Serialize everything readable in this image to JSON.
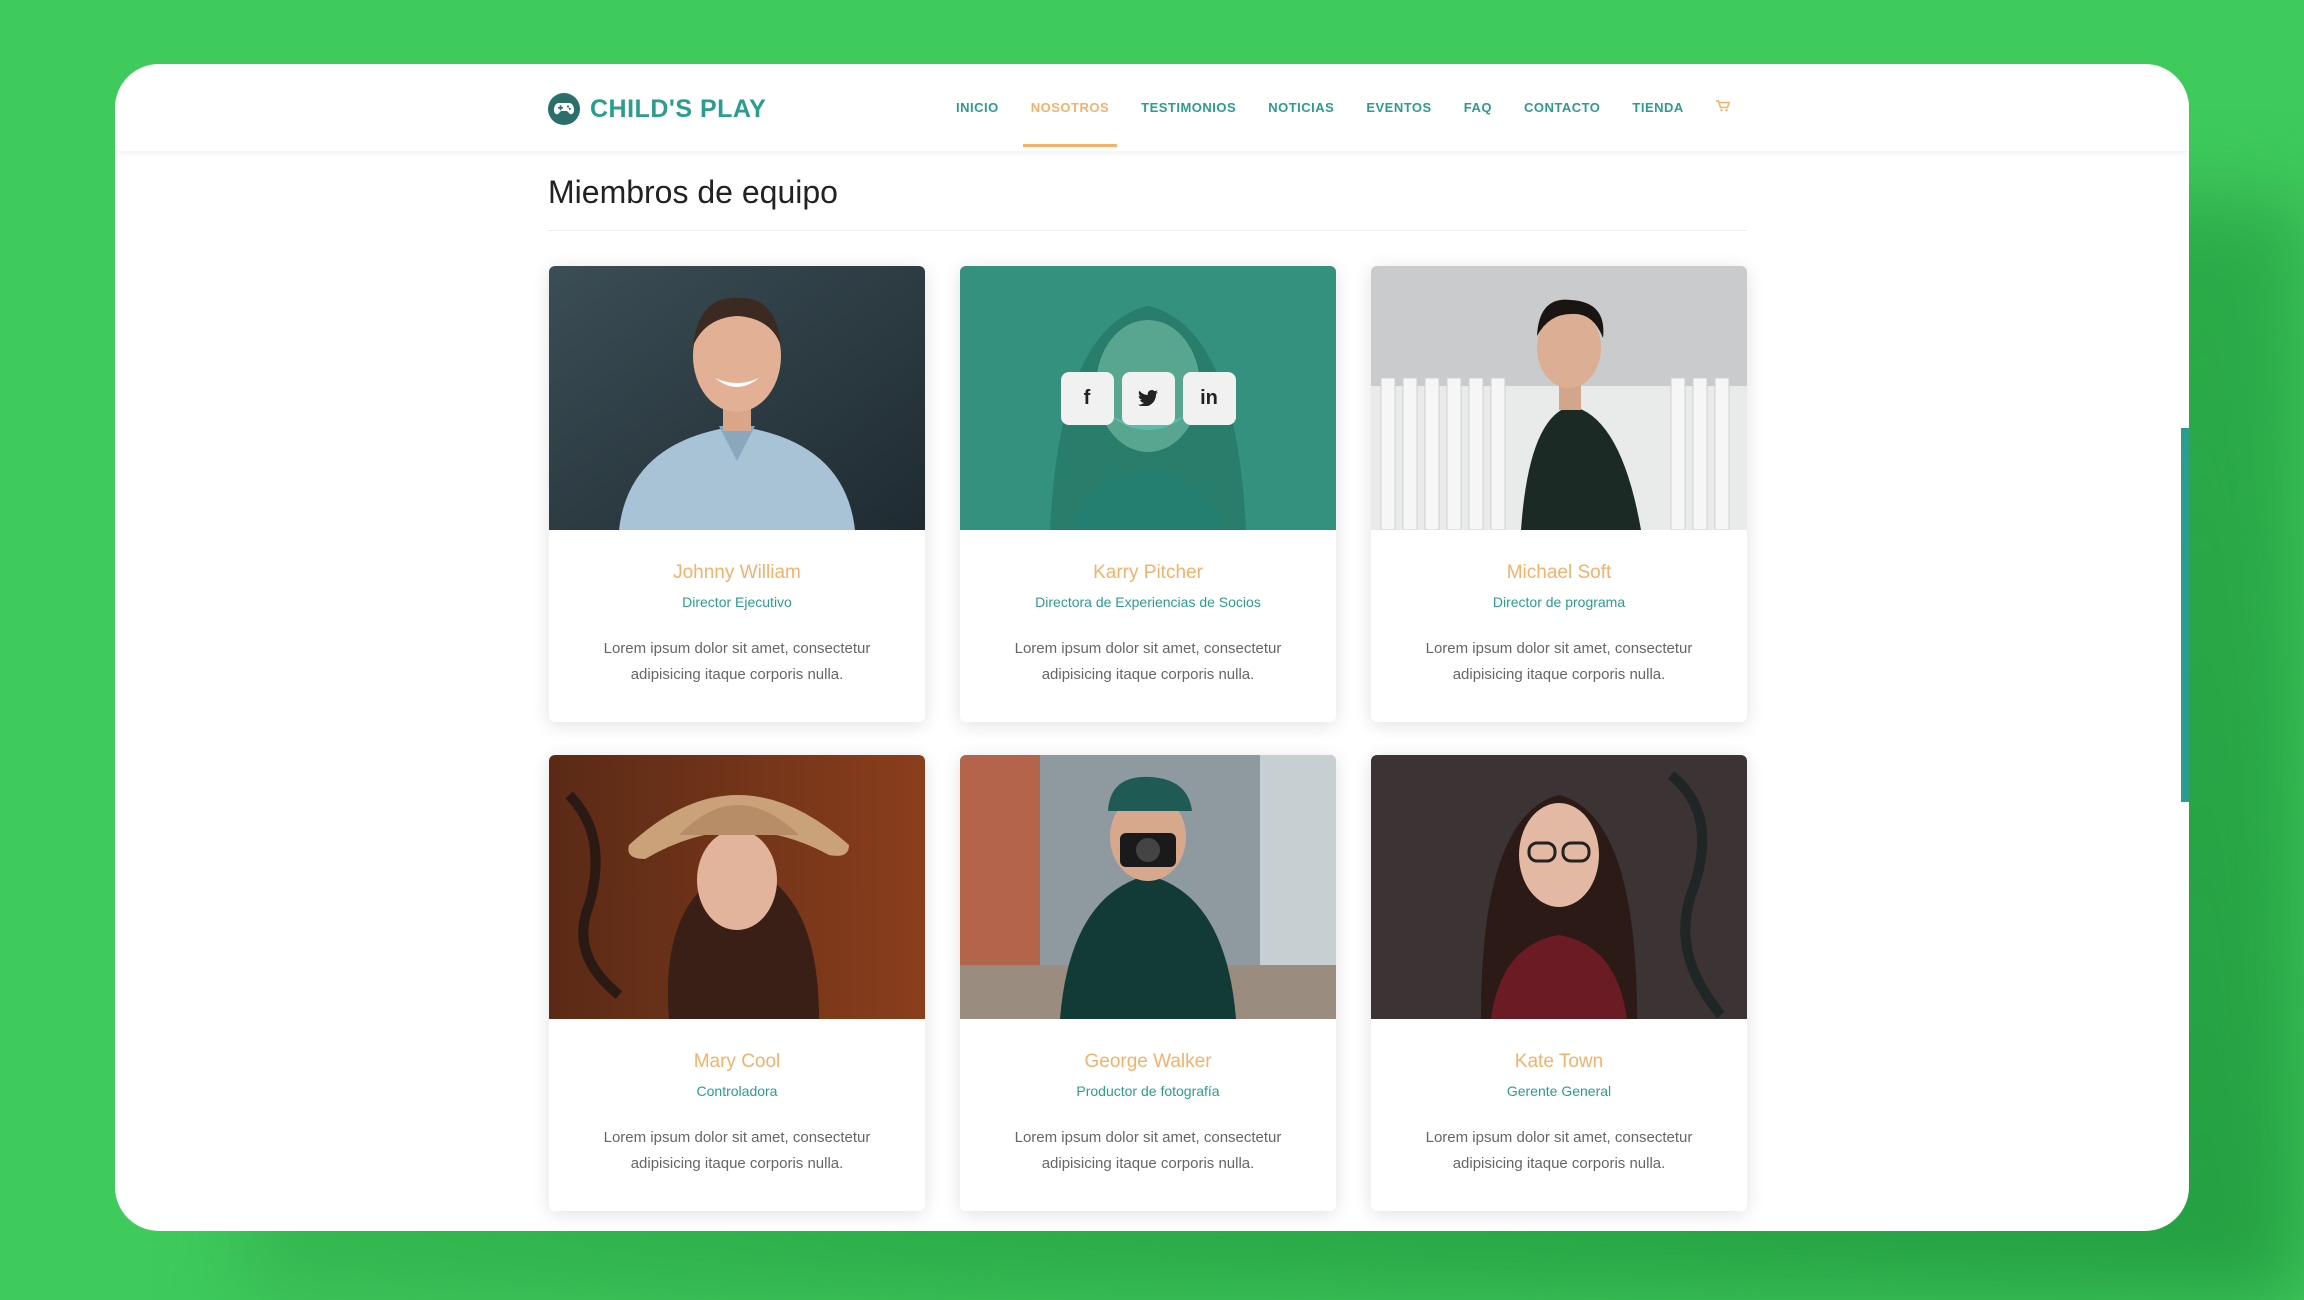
{
  "brand": {
    "name": "CHILD'S PLAY"
  },
  "nav": {
    "items": [
      "INICIO",
      "NOSOTROS",
      "TESTIMONIOS",
      "NOTICIAS",
      "EVENTOS",
      "FAQ",
      "CONTACTO",
      "TIENDA"
    ],
    "active": "NOSOTROS",
    "cart_icon": "cart-icon"
  },
  "section": {
    "title": "Miembros de equipo"
  },
  "social": [
    "f",
    "t",
    "in"
  ],
  "members": [
    {
      "name": "Johnny William",
      "role": "Director Ejecutivo",
      "desc": "Lorem ipsum dolor sit amet, consectetur adipisicing itaque corporis nulla."
    },
    {
      "name": "Karry Pitcher",
      "role": "Directora de Experiencias de Socios",
      "desc": "Lorem ipsum dolor sit amet, consectetur adipisicing itaque corporis nulla."
    },
    {
      "name": "Michael Soft",
      "role": "Director de programa",
      "desc": "Lorem ipsum dolor sit amet, consectetur adipisicing itaque corporis nulla."
    },
    {
      "name": "Mary Cool",
      "role": "Controladora",
      "desc": "Lorem ipsum dolor sit amet, consectetur adipisicing itaque corporis nulla."
    },
    {
      "name": "George Walker",
      "role": "Productor de fotografía",
      "desc": "Lorem ipsum dolor sit amet, consectetur adipisicing itaque corporis nulla."
    },
    {
      "name": "Kate Town",
      "role": "Gerente General",
      "desc": "Lorem ipsum dolor sit amet, consectetur adipisicing itaque corporis nulla."
    }
  ],
  "colors": {
    "background": "#3fca5c",
    "primary": "#2a9d8f",
    "accent": "#f4b16a"
  }
}
